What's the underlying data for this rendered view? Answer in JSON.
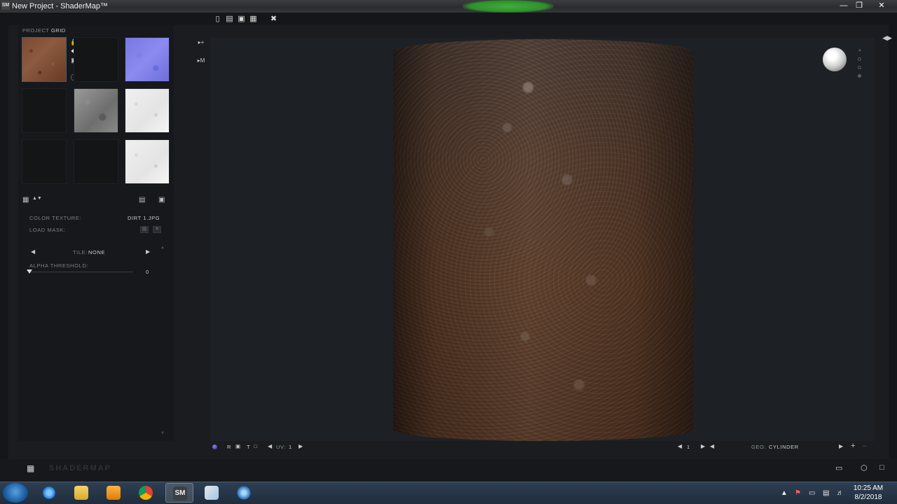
{
  "window": {
    "title": "New Project - ShaderMap™",
    "app_icon_text": "SM",
    "controls": [
      "minimize",
      "maximize",
      "close"
    ]
  },
  "toolbar": {
    "icons": [
      "new-file-icon",
      "open-folder-icon",
      "save-icon",
      "save-as-icon",
      "settings-tools-icon"
    ]
  },
  "project": {
    "label_prefix": "PROJECT",
    "label_value": "GRID",
    "slots": [
      {
        "name": "color",
        "texture": "dirt",
        "selected": true
      },
      {
        "name": "empty-1",
        "texture": "none"
      },
      {
        "name": "normal",
        "texture": "normal-blue"
      },
      {
        "name": "empty-2",
        "texture": "none"
      },
      {
        "name": "displacement",
        "texture": "gray-displacement"
      },
      {
        "name": "ambient-occlusion",
        "texture": "white"
      },
      {
        "name": "empty-3",
        "texture": "none"
      },
      {
        "name": "empty-4",
        "texture": "none"
      },
      {
        "name": "specular",
        "texture": "white"
      }
    ],
    "slot_tools": {
      "normal_letter": "N",
      "info_icon": "ⓘ"
    }
  },
  "properties": {
    "color_texture_label": "COLOR TEXTURE:",
    "color_texture_value": "DIRT 1.JPG",
    "load_mask_label": "LOAD MASK:",
    "tile_label": "TILE:",
    "tile_value": "NONE",
    "alpha_threshold_label": "ALPHA THRESHOLD:",
    "alpha_threshold_value": "0",
    "alpha_threshold_fraction": 0
  },
  "status": {
    "uv_label": "UV:",
    "uv_value": "1",
    "letters": [
      "R",
      "T"
    ],
    "page_value": "1",
    "geo_label": "GEO:",
    "geo_value": "CYLINDER"
  },
  "bottom": {
    "brand": "SHADERMAP"
  },
  "taskbar": {
    "apps": [
      "internet-explorer",
      "file-explorer",
      "media-player",
      "chrome",
      "shadermap",
      "paint",
      "network"
    ],
    "active_app": "shadermap",
    "clock_time": "10:25 AM",
    "clock_date": "8/2/2018"
  },
  "colors": {
    "accent_blue": "#7f7fe8",
    "dirt_brown": "#5c3c28",
    "viewport_bg": "#1d2024"
  }
}
